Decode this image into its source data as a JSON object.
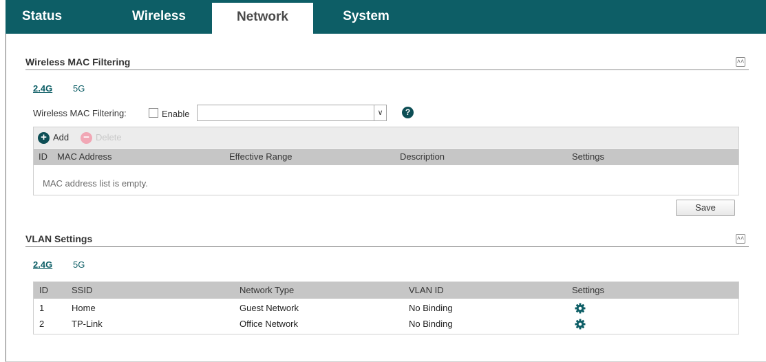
{
  "nav": {
    "tabs": [
      {
        "label": "Status",
        "active": false
      },
      {
        "label": "Wireless",
        "active": false
      },
      {
        "label": "Network",
        "active": true
      },
      {
        "label": "System",
        "active": false
      }
    ]
  },
  "mac_filtering": {
    "title": "Wireless MAC Filtering",
    "bands": [
      "2.4G",
      "5G"
    ],
    "active_band": "2.4G",
    "filter_label": "Wireless MAC Filtering:",
    "enable_label": "Enable",
    "enable_checked": false,
    "mode_value": "",
    "toolbar": {
      "add_label": "Add",
      "delete_label": "Delete"
    },
    "columns": [
      "ID",
      "MAC Address",
      "Effective Range",
      "Description",
      "Settings"
    ],
    "rows": [],
    "empty_message": "MAC address list is empty.",
    "save_label": "Save"
  },
  "vlan": {
    "title": "VLAN Settings",
    "bands": [
      "2.4G",
      "5G"
    ],
    "active_band": "2.4G",
    "columns": [
      "ID",
      "SSID",
      "Network Type",
      "VLAN ID",
      "Settings"
    ],
    "rows": [
      {
        "id": "1",
        "ssid": "Home",
        "network_type": "Guest Network",
        "vlan_id": "No Binding",
        "settings_icon": "gear-icon"
      },
      {
        "id": "2",
        "ssid": "TP-Link",
        "network_type": "Office Network",
        "vlan_id": "No Binding",
        "settings_icon": "gear-icon"
      }
    ]
  },
  "colors": {
    "accent": "#0d5e66",
    "header_bg": "#c6c6c6",
    "toolbar_bg": "#ececec",
    "delete_disabled": "#f1a7b5"
  },
  "icons": {
    "collapse": "double-chevron-up-icon",
    "help": "question-icon",
    "add": "plus-circle-icon",
    "delete": "minus-circle-icon",
    "dropdown": "chevron-down-icon"
  }
}
